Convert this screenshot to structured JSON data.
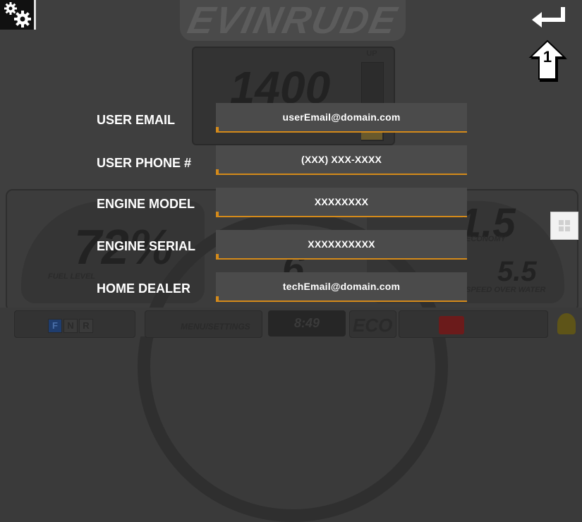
{
  "header": {
    "brand": "EVINRUDE",
    "settings_icon": "settings-gears-icon",
    "back_icon": "return-enter-icon"
  },
  "callout": {
    "number": "1",
    "icon": "up-arrow-callout-icon"
  },
  "background_dashboard": {
    "rpm": "1400",
    "trim_label": "UP",
    "fuel_level_value": "72%",
    "fuel_level_label": "FUEL LEVEL",
    "economy_value": "1.5",
    "economy_label": "ECONOMY",
    "speed_center": "6",
    "speed_over_water_value": "5.5",
    "speed_over_water_label": "SPEED OVER WATER",
    "gears": [
      "F",
      "N",
      "R"
    ],
    "active_gear": "F",
    "menu_label": "MENU/SETTINGS",
    "clock": "8:49",
    "eco_label": "ECO"
  },
  "form": {
    "rows": [
      {
        "label": "USER EMAIL",
        "value": "userEmail@domain.com"
      },
      {
        "label": "USER PHONE #",
        "value": "(XXX) XXX-XXXX"
      },
      {
        "label": "ENGINE MODEL",
        "value": "XXXXXXXX"
      },
      {
        "label": "ENGINE SERIAL",
        "value": "XXXXXXXXXX"
      },
      {
        "label": "HOME DEALER",
        "value": "techEmail@domain.com"
      }
    ]
  },
  "colors": {
    "accent_underline": "#d48a1a",
    "field_bg": "#4b4b4b",
    "overlay_bg": "#3f3f3f"
  }
}
